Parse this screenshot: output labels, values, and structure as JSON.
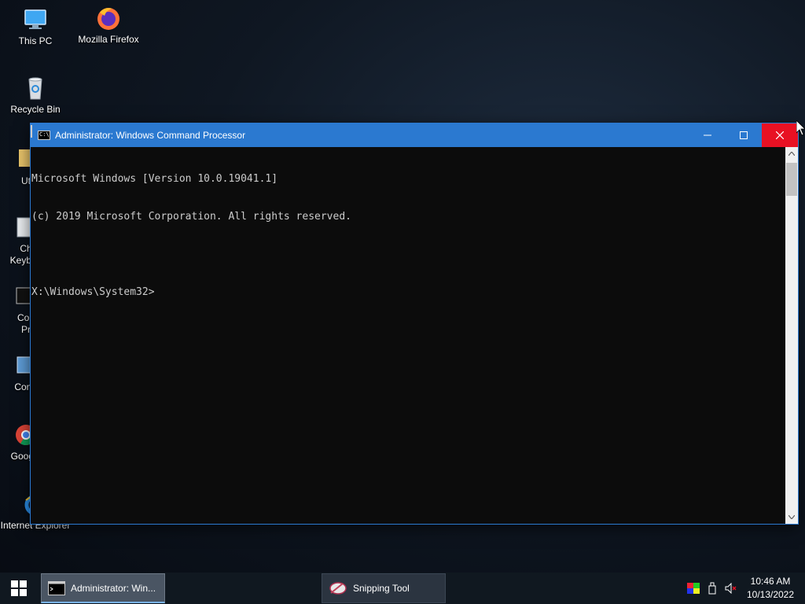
{
  "desktop": {
    "icons": [
      {
        "label": "This PC",
        "icon": "this-pc-icon"
      },
      {
        "label": "Mozilla Firefox",
        "icon": "firefox-icon"
      },
      {
        "label": "Recycle Bin",
        "icon": "recycle-bin-icon"
      },
      {
        "label": "Ut",
        "icon": "utilities-icon"
      },
      {
        "label": "Ch",
        "icon": "character-map-icon"
      },
      {
        "label": "Keyboa",
        "icon": "keyboard-icon"
      },
      {
        "label": "Con",
        "icon": "command-prompt-icon"
      },
      {
        "label": "Pr",
        "icon": "command-prompt-icon"
      },
      {
        "label": "Contr",
        "icon": "control-panel-icon"
      },
      {
        "label": "Google",
        "icon": "chrome-icon"
      },
      {
        "label": "Internet Explorer",
        "icon": "internet-explorer-icon"
      }
    ]
  },
  "window": {
    "title": "Administrator: Windows Command Processor",
    "buttons": {
      "minimize": "minimize",
      "maximize": "maximize",
      "close": "close"
    },
    "console_lines": [
      "Microsoft Windows [Version 10.0.19041.1]",
      "(c) 2019 Microsoft Corporation. All rights reserved.",
      "",
      "X:\\Windows\\System32>"
    ]
  },
  "taskbar": {
    "items": [
      {
        "label": "Administrator: Win...",
        "active": true,
        "icon": "cmd-icon"
      },
      {
        "label": "Snipping Tool",
        "active": false,
        "icon": "snipping-tool-icon"
      }
    ],
    "clock": {
      "time": "10:46 AM",
      "date": "10/13/2022"
    }
  },
  "colors": {
    "titlebar": "#2b79d0",
    "close": "#e81123",
    "console_bg": "#0c0c0c",
    "console_text": "#cccccc"
  }
}
